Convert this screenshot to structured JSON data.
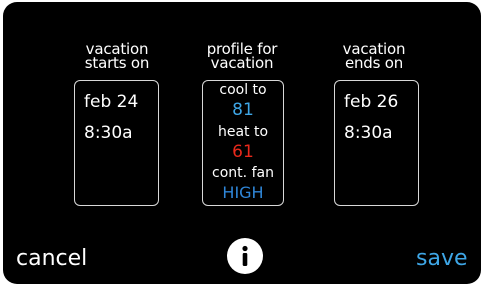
{
  "vacation_start": {
    "heading_line1": "vacation",
    "heading_line2": "starts on",
    "date": "feb 24",
    "time": "8:30a"
  },
  "profile": {
    "heading_line1": "profile for",
    "heading_line2": "vacation",
    "cool_label": "cool to",
    "cool_value": "81",
    "heat_label": "heat to",
    "heat_value": "61",
    "fan_label": "cont. fan",
    "fan_value": "HIGH"
  },
  "vacation_end": {
    "heading_line1": "vacation",
    "heading_line2": "ends on",
    "date": "feb 26",
    "time": "8:30a"
  },
  "footer": {
    "cancel_label": "cancel",
    "save_label": "save",
    "info_icon": "info-icon"
  },
  "colors": {
    "background": "#000000",
    "text": "#ffffff",
    "cool": "#3ea6e6",
    "heat": "#e8291b",
    "fan": "#2f86d8",
    "save": "#3ea6e6"
  }
}
